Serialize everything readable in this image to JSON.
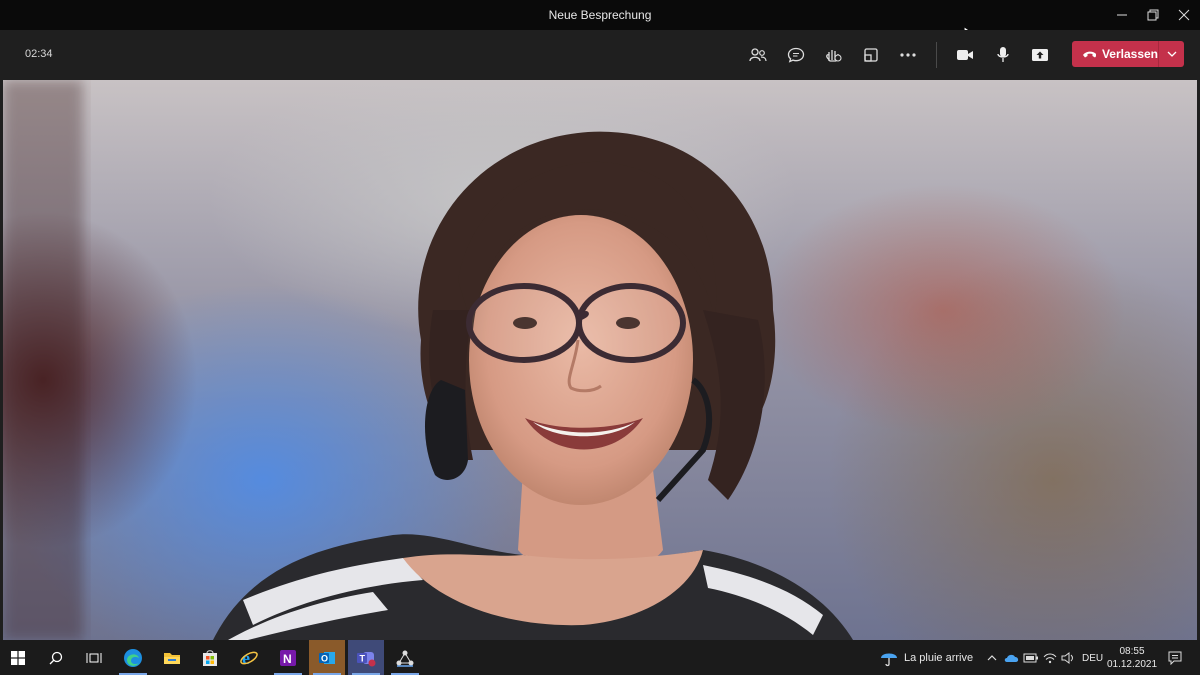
{
  "window": {
    "title": "Neue Besprechung"
  },
  "meeting": {
    "timer": "02:34",
    "leave_label": "Verlassen",
    "leave_color": "#c4314b"
  },
  "toolbar_icons": [
    "participants-icon",
    "chat-icon",
    "raise-hand-icon",
    "rooms-icon",
    "more-icon",
    "camera-icon",
    "microphone-icon",
    "share-icon"
  ],
  "taskbar": {
    "apps": [
      "start",
      "search",
      "task-view",
      "edge",
      "file-explorer",
      "store",
      "internet-explorer",
      "onenote",
      "outlook",
      "teams",
      "network-app"
    ],
    "weather_text": "La pluie arrive",
    "language": "DEU",
    "time": "08:55",
    "date": "01.12.2021"
  }
}
